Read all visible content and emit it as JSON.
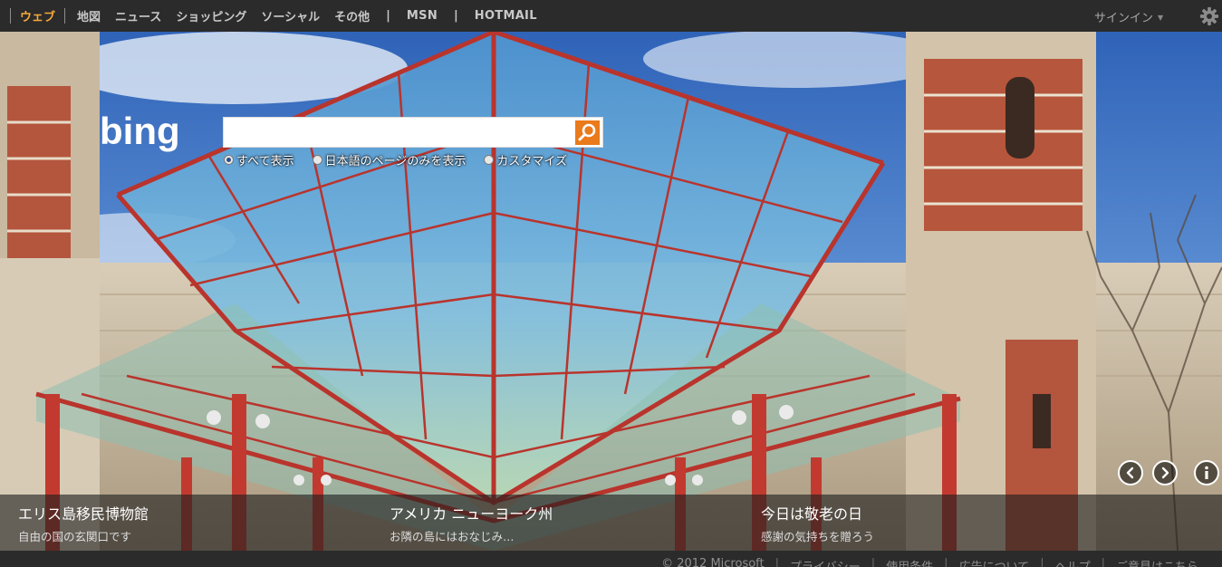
{
  "nav": {
    "items": [
      {
        "label": "ウェブ",
        "active": true
      },
      {
        "label": "地図"
      },
      {
        "label": "ニュース"
      },
      {
        "label": "ショッピング"
      },
      {
        "label": "ソーシャル"
      },
      {
        "label": "その他"
      }
    ],
    "msn": "MSN",
    "hotmail": "HOTMAIL",
    "pipe": "|",
    "signin": "サインイン",
    "signin_caret": "▼",
    "settings_icon": "gear-icon"
  },
  "search": {
    "value": "",
    "button_icon": "search-icon",
    "options": [
      {
        "label": "すべて表示",
        "selected": true
      },
      {
        "label": "日本語のページのみを表示",
        "selected": false
      },
      {
        "label": "カスタマイズ",
        "selected": false
      }
    ]
  },
  "logo": {
    "text": "bing"
  },
  "hero": {
    "prev_icon": "chevron-left-icon",
    "next_icon": "chevron-right-icon",
    "info_icon": "info-icon",
    "captions": [
      {
        "title": "エリス島移民博物館",
        "subtitle": "自由の国の玄関口です"
      },
      {
        "title": "アメリカ ニューヨーク州",
        "subtitle": "お隣の島にはおなじみ…"
      },
      {
        "title": "今日は敬老の日",
        "subtitle": "感謝の気持ちを贈ろう"
      }
    ]
  },
  "footer": {
    "copyright": "© 2012 Microsoft",
    "links": [
      "プライバシー",
      "使用条件",
      "広告について",
      "ヘルプ",
      "ご意見はこちら"
    ],
    "sep": "|"
  },
  "colors": {
    "accent_active": "#f6a93b",
    "search_button": "#ea7a1b",
    "topbar": "#2b2b2b"
  }
}
